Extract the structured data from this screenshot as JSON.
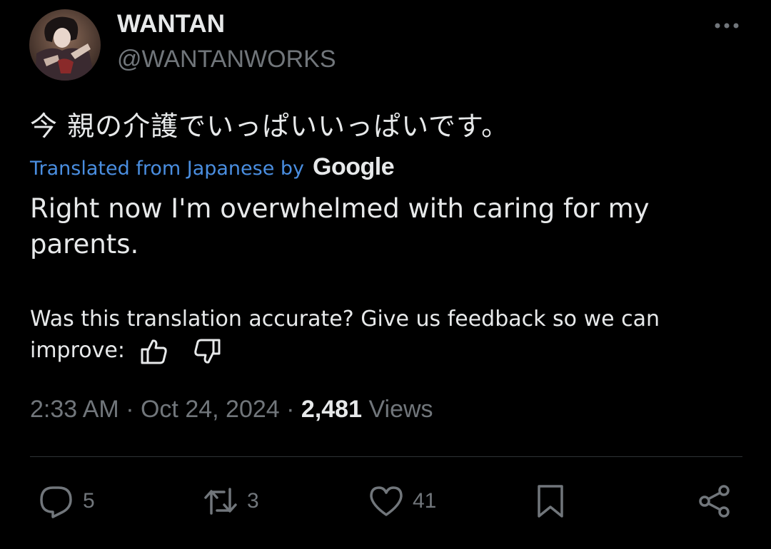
{
  "tweet": {
    "display_name": "WANTAN",
    "handle": "@WANTANWORKS",
    "avatar_icon": "user-avatar-artwork",
    "original_text": "今 親の介護でいっぱいいっぱいです。",
    "translated_label": "Translated from Japanese by",
    "google_logo_text": "Google",
    "translation": "Right now I'm overwhelmed with caring for my parents.",
    "feedback_prompt": "Was this translation accurate? Give us feedback so we can improve:",
    "time": "2:33 AM",
    "date": "Oct 24, 2024",
    "views_count": "2,481",
    "views_label": "Views"
  },
  "actions": {
    "reply_count": "5",
    "repost_count": "3",
    "like_count": "41"
  },
  "icons": {
    "more": "more-horizontal-icon",
    "thumbs_up": "thumbs-up-icon",
    "thumbs_down": "thumbs-down-icon",
    "reply": "reply-icon",
    "repost": "repost-icon",
    "like": "heart-icon",
    "bookmark": "bookmark-icon",
    "share": "share-icon"
  },
  "colors": {
    "background": "#000000",
    "primary_text": "#e7e9ea",
    "secondary_text": "#71767b",
    "link": "#4a8ee0",
    "divider": "#2f3336"
  }
}
